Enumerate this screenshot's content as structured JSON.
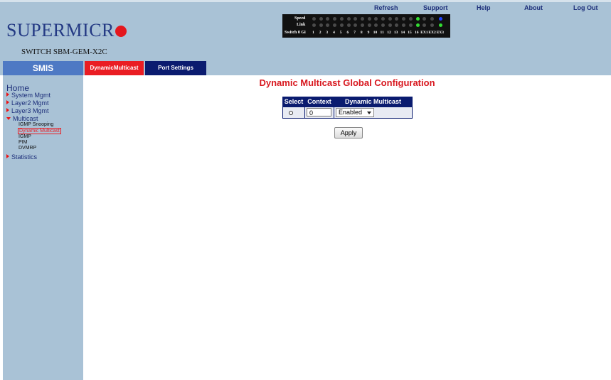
{
  "brand": {
    "logo_text": "SUPERMICR",
    "model": "SWITCH SBM-GEM-X2C"
  },
  "toplinks": [
    "Refresh",
    "Support",
    "Help",
    "About",
    "Log Out"
  ],
  "port_panel": {
    "row_labels": [
      "Speed",
      "Link",
      "Switch 0 Gi"
    ],
    "ports": [
      "1",
      "2",
      "3",
      "4",
      "5",
      "6",
      "7",
      "8",
      "9",
      "10",
      "11",
      "12",
      "13",
      "14",
      "15",
      "16",
      "EX1",
      "EX2",
      "EX3"
    ],
    "speed_leds": [
      "off",
      "off",
      "off",
      "off",
      "off",
      "off",
      "off",
      "off",
      "off",
      "off",
      "off",
      "off",
      "off",
      "off",
      "off",
      "green",
      "off",
      "off",
      "blue"
    ],
    "link_leds": [
      "off",
      "off",
      "off",
      "off",
      "off",
      "off",
      "off",
      "off",
      "off",
      "off",
      "off",
      "off",
      "off",
      "off",
      "off",
      "green",
      "off",
      "off",
      "green"
    ]
  },
  "nav": {
    "smis": "SMIS",
    "tab_dynamic": "DynamicMulticast",
    "tab_port": "Port Settings"
  },
  "sidebar": {
    "home": "Home",
    "items": [
      "System Mgmt",
      "Layer2 Mgmt",
      "Layer3 Mgmt",
      "Multicast",
      "Statistics"
    ],
    "multicast_sub": [
      "IGMP Snooping",
      "Dynamic Multicast",
      "IGMP",
      "PIM",
      "DVMRP"
    ]
  },
  "content": {
    "title": "Dynamic Multicast Global Configuration",
    "columns": [
      "Select",
      "Context",
      "Dynamic Multicast Status"
    ],
    "row": {
      "context": "0",
      "status": "Enabled"
    },
    "apply": "Apply"
  },
  "colors": {
    "header_bg": "#a9c2d6",
    "accent_red": "#ea1d23",
    "navy": "#0a1b6f",
    "smis_blue": "#4e79c4"
  }
}
